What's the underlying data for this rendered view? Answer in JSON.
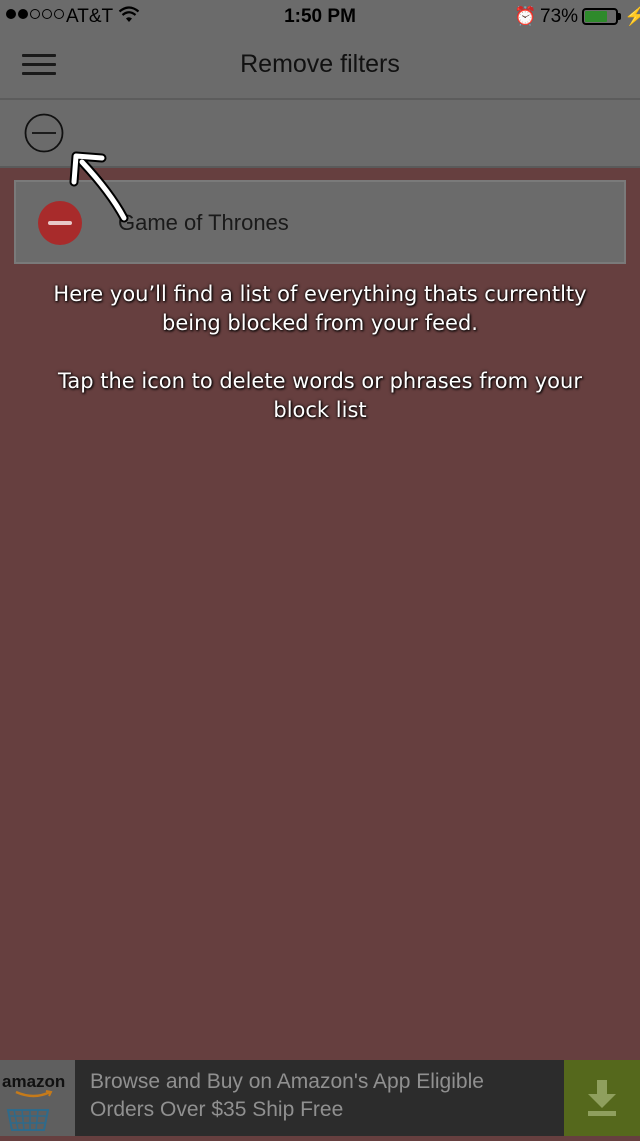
{
  "status_bar": {
    "carrier": "AT&T",
    "time": "1:50 PM",
    "battery_percent": "73%",
    "battery_level": 0.73,
    "signal_bars": 2,
    "icons": [
      "wifi-icon",
      "alarm-icon",
      "battery-icon",
      "charging-bolt-icon"
    ]
  },
  "header": {
    "title": "Remove filters",
    "menu_icon": "hamburger-menu-icon"
  },
  "toolbar": {
    "remove_icon": "circle-minus-icon"
  },
  "filters": [
    {
      "label": "Game of Thrones",
      "delete_icon": "delete-minus-icon"
    }
  ],
  "help_overlay": {
    "line1": "Here you’ll find a list of everything thats currentlty being blocked from your feed.",
    "line2": "Tap the icon to delete words or phrases from your block list",
    "arrow_icon": "pointer-arrow-icon"
  },
  "ad": {
    "brand": "amazon",
    "text_line1": "Browse and Buy on Amazon's App Eligible",
    "text_line2": "Orders Over $35 Ship Free",
    "download_icon": "download-arrow-icon"
  },
  "colors": {
    "overlay": "#663f3f",
    "delete_red": "#a82b2b",
    "ad_green": "#55681c"
  }
}
